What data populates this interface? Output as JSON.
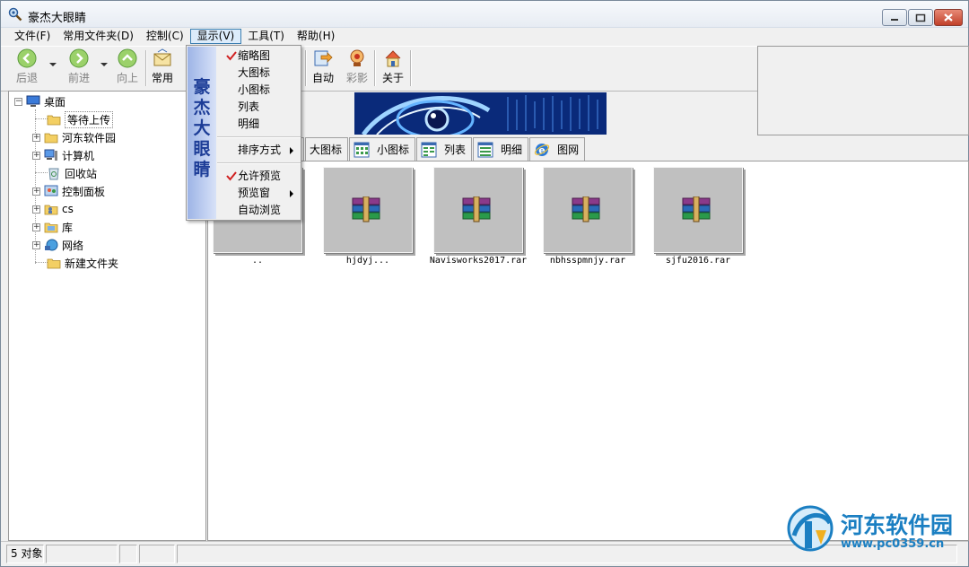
{
  "window": {
    "title": "豪杰大眼睛"
  },
  "menubar": {
    "items": [
      "文件(F)",
      "常用文件夹(D)",
      "控制(C)",
      "显示(V)",
      "工具(T)",
      "帮助(H)"
    ]
  },
  "toolbar": {
    "back": "后退",
    "forward": "前进",
    "up": "向上",
    "common": "常用",
    "auto": "自动",
    "slideshow": "彩影",
    "about": "关于"
  },
  "tree": {
    "items": [
      "桌面",
      "等待上传",
      "河东软件园",
      "计算机",
      "回收站",
      "控制面板",
      "cs",
      "库",
      "网络",
      "新建文件夹"
    ]
  },
  "tabs": [
    "大图标",
    "小图标",
    "列表",
    "明细",
    "图网"
  ],
  "files": [
    {
      "name": ".."
    },
    {
      "name": "hjdyj..."
    },
    {
      "name": "Navisworks2017.rar"
    },
    {
      "name": "nbhsspmnjy.rar"
    },
    {
      "name": "sjfu2016.rar"
    }
  ],
  "status": {
    "count": "5 对象"
  },
  "dropdown": {
    "side_text": "豪杰大眼睛",
    "items": [
      "缩略图",
      "大图标",
      "小图标",
      "列表",
      "明细",
      "排序方式",
      "允许预览",
      "预览窗",
      "自动浏览"
    ],
    "checked": [
      "缩略图",
      "允许预览"
    ]
  },
  "watermark": {
    "title": "河东软件园",
    "url": "www.pc0359.cn"
  },
  "colors": {
    "accent": "#1b7fc2",
    "menu_side": "#9db4e6",
    "banner": "#0a2a7a"
  }
}
